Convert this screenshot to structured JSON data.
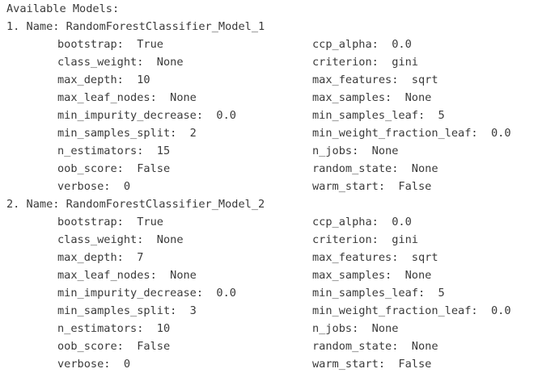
{
  "header": "Available Models:",
  "models": [
    {
      "line": "1. Name: RandomForestClassifier_Model_1",
      "params": [
        "bootstrap:  True",
        "ccp_alpha:  0.0",
        "class_weight:  None",
        "criterion:  gini",
        "max_depth:  10",
        "max_features:  sqrt",
        "max_leaf_nodes:  None",
        "max_samples:  None",
        "min_impurity_decrease:  0.0",
        "min_samples_leaf:  5",
        "min_samples_split:  2",
        "min_weight_fraction_leaf:  0.0",
        "n_estimators:  15",
        "n_jobs:  None",
        "oob_score:  False",
        "random_state:  None",
        "verbose:  0",
        "warm_start:  False"
      ]
    },
    {
      "line": "2. Name: RandomForestClassifier_Model_2",
      "params": [
        "bootstrap:  True",
        "ccp_alpha:  0.0",
        "class_weight:  None",
        "criterion:  gini",
        "max_depth:  7",
        "max_features:  sqrt",
        "max_leaf_nodes:  None",
        "max_samples:  None",
        "min_impurity_decrease:  0.0",
        "min_samples_leaf:  5",
        "min_samples_split:  3",
        "min_weight_fraction_leaf:  0.0",
        "n_estimators:  10",
        "n_jobs:  None",
        "oob_score:  False",
        "random_state:  None",
        "verbose:  0",
        "warm_start:  False"
      ]
    }
  ]
}
